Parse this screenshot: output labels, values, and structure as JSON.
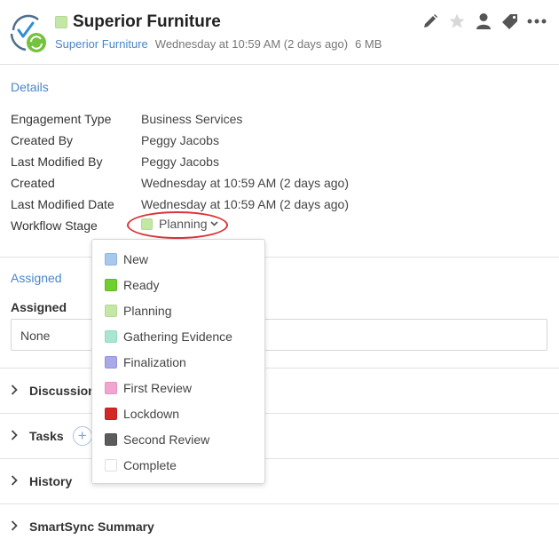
{
  "header": {
    "title": "Superior Furniture",
    "client_link": "Superior Furniture",
    "modified": "Wednesday at 10:59 AM (2 days ago)",
    "size": "6 MB",
    "status_color": "#c5e7a5",
    "actions": [
      "pencil-icon",
      "star-icon",
      "user-icon",
      "tag-icon",
      "more-icon"
    ]
  },
  "details": {
    "title": "Details",
    "rows": [
      {
        "label": "Engagement Type",
        "value": "Business Services"
      },
      {
        "label": "Created By",
        "value": "Peggy Jacobs"
      },
      {
        "label": "Last Modified By",
        "value": "Peggy Jacobs"
      },
      {
        "label": "Created",
        "value": "Wednesday at 10:59 AM (2 days ago)"
      },
      {
        "label": "Last Modified Date",
        "value": "Wednesday at 10:59 AM (2 days ago)"
      }
    ],
    "workflow_label": "Workflow Stage",
    "workflow_value": "Planning",
    "workflow_color": "#c5e7a5"
  },
  "assigned": {
    "title": "Assigned",
    "label": "Assigned",
    "value": "None"
  },
  "sections": [
    {
      "label": "Discussions"
    },
    {
      "label": "Tasks",
      "plus": "+"
    },
    {
      "label": "History"
    },
    {
      "label": "SmartSync Summary"
    }
  ],
  "dropdown": {
    "options": [
      {
        "label": "New",
        "color": "#a9c8ee"
      },
      {
        "label": "Ready",
        "color": "#6fcf2f"
      },
      {
        "label": "Planning",
        "color": "#c5e7a5"
      },
      {
        "label": "Gathering Evidence",
        "color": "#a8e6cf"
      },
      {
        "label": "Finalization",
        "color": "#a9a8e8"
      },
      {
        "label": "First Review",
        "color": "#f0a6cf"
      },
      {
        "label": "Lockdown",
        "color": "#d42828"
      },
      {
        "label": "Second Review",
        "color": "#5c5c5c"
      },
      {
        "label": "Complete",
        "color": "#ffffff"
      }
    ]
  }
}
